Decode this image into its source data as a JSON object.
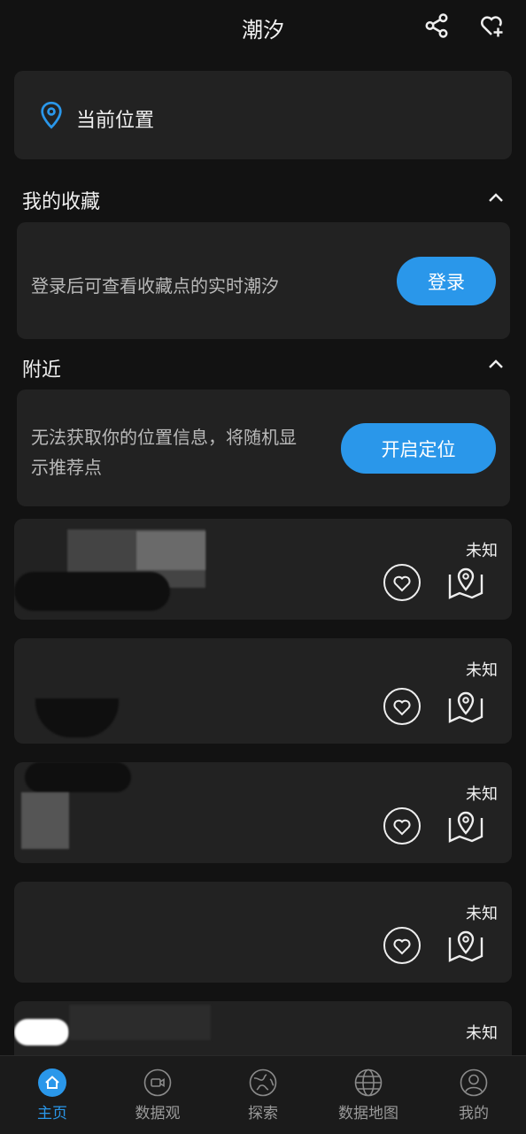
{
  "header": {
    "title": "潮汐",
    "share_icon": "share-icon",
    "favorite_add_icon": "heart-plus-icon"
  },
  "location": {
    "icon": "location-pin-icon",
    "label": "当前位置"
  },
  "favorites": {
    "title": "我的收藏",
    "message": "登录后可查看收藏点的实时潮汐",
    "login_button": "登录"
  },
  "nearby": {
    "title": "附近",
    "message_line1": "无法获取你的位置信息，将随机显",
    "message_line2": "示推荐点",
    "enable_button": "开启定位"
  },
  "stations": [
    {
      "status": "未知"
    },
    {
      "status": "未知"
    },
    {
      "status": "未知"
    },
    {
      "status": "未知"
    },
    {
      "status": "未知"
    }
  ],
  "nav": {
    "items": [
      {
        "label": "主页",
        "icon": "home-icon"
      },
      {
        "label": "数据观",
        "icon": "camera-icon"
      },
      {
        "label": "探索",
        "icon": "globe-icon"
      },
      {
        "label": "数据地图",
        "icon": "world-map-icon"
      },
      {
        "label": "我的",
        "icon": "profile-icon"
      }
    ]
  },
  "colors": {
    "accent": "#2a97ea",
    "background": "#121212",
    "card": "#222222"
  }
}
